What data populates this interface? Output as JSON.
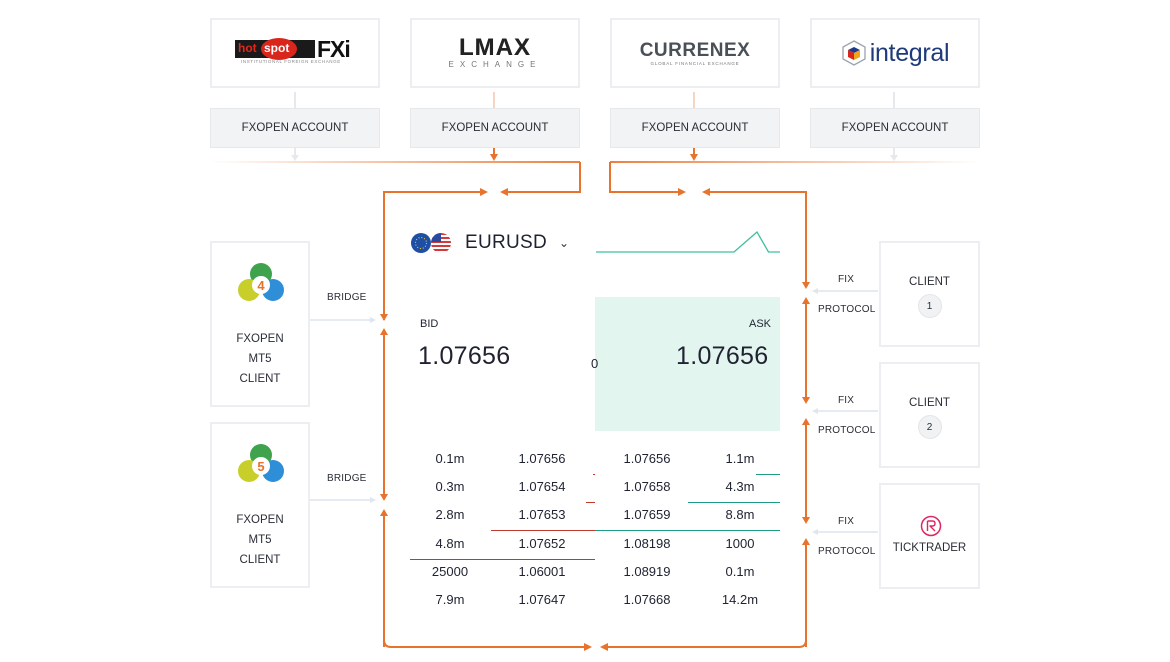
{
  "liquidity_providers": [
    {
      "name": "hotspot FXi",
      "logo_main": "hot spot",
      "logo_suffix": "FXi",
      "tagline": "INSTITUTIONAL FOREIGN EXCHANGE",
      "account_label": "FXOPEN ACCOUNT",
      "active": false
    },
    {
      "name": "LMAX Exchange",
      "logo_main": "LMAX",
      "tagline": "EXCHANGE",
      "account_label": "FXOPEN ACCOUNT",
      "active": true
    },
    {
      "name": "Currenex",
      "logo_main": "CURRENEX",
      "tagline": "GLOBAL FINANCIAL EXCHANGE",
      "account_label": "FXOPEN ACCOUNT",
      "active": true
    },
    {
      "name": "integral",
      "logo_main": "integral",
      "account_label": "FXOPEN ACCOUNT",
      "active": false
    }
  ],
  "left_clients": [
    {
      "icon": "metatrader-4-icon",
      "version": "4",
      "lines": [
        "FXOPEN",
        "MT5",
        "CLIENT"
      ],
      "connection": "BRIDGE"
    },
    {
      "icon": "metatrader-5-icon",
      "version": "5",
      "lines": [
        "FXOPEN",
        "MT5",
        "CLIENT"
      ],
      "connection": "BRIDGE"
    }
  ],
  "right_clients": [
    {
      "label": "CLIENT",
      "badge": "1",
      "conn_top": "FIX",
      "conn_bottom": "PROTOCOL"
    },
    {
      "label": "CLIENT",
      "badge": "2",
      "conn_top": "FIX",
      "conn_bottom": "PROTOCOL"
    },
    {
      "label": "TICKTRADER",
      "icon": "ticktrader-icon",
      "conn_top": "FIX",
      "conn_bottom": "PROTOCOL"
    }
  ],
  "quote": {
    "symbol": "EURUSD",
    "bid_label": "BID",
    "ask_label": "ASK",
    "bid": "1.07656",
    "ask": "1.07656",
    "spread": "0",
    "sparkline": [
      0,
      0,
      0,
      0,
      0,
      0,
      0,
      0,
      0,
      0,
      0,
      0,
      0,
      0.5,
      1,
      0,
      0
    ]
  },
  "order_book": {
    "rows": [
      {
        "bid_vol": "0.1m",
        "bid": "1.07656",
        "ask": "1.07656",
        "ask_vol": "1.1m"
      },
      {
        "bid_vol": "0.3m",
        "bid": "1.07654",
        "ask": "1.07658",
        "ask_vol": "4.3m"
      },
      {
        "bid_vol": "2.8m",
        "bid": "1.07653",
        "ask": "1.07659",
        "ask_vol": "8.8m"
      },
      {
        "bid_vol": "4.8m",
        "bid": "1.07652",
        "ask": "1.08198",
        "ask_vol": "1000"
      },
      {
        "bid_vol": "25000",
        "bid": "1.06001",
        "ask": "1.08919",
        "ask_vol": "0.1m"
      },
      {
        "bid_vol": "7.9m",
        "bid": "1.07647",
        "ask": "1.07668",
        "ask_vol": "14.2m"
      }
    ],
    "bid_depth": [
      0.01,
      0.05,
      0.56,
      1.0,
      0.0,
      0.0
    ],
    "ask_depth": [
      0.13,
      0.5,
      1.0,
      0.0,
      0.0,
      0.0
    ]
  },
  "colors": {
    "flow_orange": "#e8732c",
    "muted_line": "#e6ebf2",
    "ask_bg": "#e3f5ef",
    "bid_depth": "#c23a2e",
    "ask_depth": "#1f9c85",
    "sparkline": "#3fbf9f"
  }
}
